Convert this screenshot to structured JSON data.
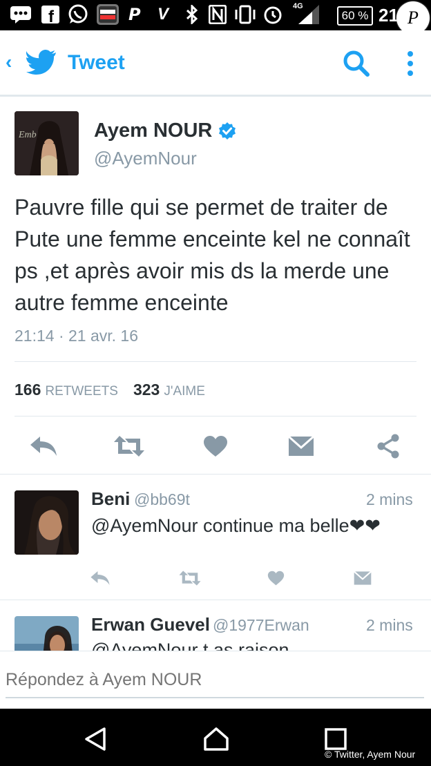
{
  "status_bar": {
    "network": "4G",
    "battery": "60 %",
    "clock": "21",
    "watermark": "P"
  },
  "app_bar": {
    "back_glyph": "‹",
    "title": "Tweet",
    "icons": [
      "chevron-left-icon",
      "twitter-bird-icon",
      "search-icon",
      "more-vertical-icon"
    ]
  },
  "tweet": {
    "author_name": "Ayem NOUR",
    "verified": true,
    "handle": "@AyemNour",
    "text": "Pauvre fille qui se permet de traiter de Pute une femme enceinte kel ne connaît ps ,et après avoir mis ds la merde une autre femme enceinte",
    "timestamp": "21:14 · 21 avr. 16",
    "retweets": "166",
    "retweets_label": "RETWEETS",
    "likes": "323",
    "likes_label": "J'AIME",
    "actions": [
      "reply-icon",
      "retweet-icon",
      "like-icon",
      "direct-message-icon",
      "share-icon"
    ]
  },
  "replies": [
    {
      "name": "Beni",
      "handle": "@bb69t",
      "time": "2 mins",
      "text": "@AyemNour continue ma belle❤❤"
    },
    {
      "name": "Erwan Guevel",
      "handle": "@1977Erwan",
      "time": "2 mins",
      "text": "@AyemNour t as raison"
    }
  ],
  "composer": {
    "placeholder": "Répondez à Ayem NOUR"
  },
  "nav_bar": {
    "icons": [
      "back-triangle-icon",
      "home-icon",
      "recents-square-icon"
    ]
  },
  "credit": "© Twitter, Ayem Nour",
  "colors": {
    "accent": "#1da1f2",
    "text": "#292f33",
    "muted": "#8899a6",
    "divider": "#e1e8ed",
    "verified": "#1da1f2"
  }
}
